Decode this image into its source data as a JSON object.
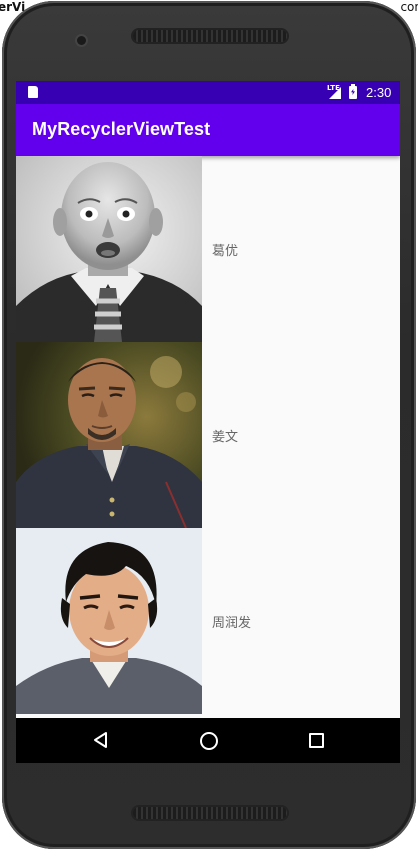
{
  "window": {
    "cut_title_left": "erVi",
    "cut_title_right": "con"
  },
  "status_bar": {
    "network": "LTE",
    "time": "2:30",
    "icons": [
      "sd-card-icon",
      "lte-signal-icon",
      "battery-charging-icon"
    ]
  },
  "app_bar": {
    "title": "MyRecyclerViewTest"
  },
  "list": {
    "items": [
      {
        "name": "葛优",
        "image": "bald-man-portrait"
      },
      {
        "name": "姜文",
        "image": "man-in-jacket-portrait"
      },
      {
        "name": "周润发",
        "image": "smiling-man-portrait"
      }
    ]
  },
  "nav_bar": {
    "icons": [
      "back-icon",
      "home-icon",
      "recents-icon"
    ]
  },
  "colors": {
    "status_bar": "#3700b3",
    "app_bar": "#6200ee",
    "list_background": "#fafafa",
    "nav_bar": "#000000",
    "item_text": "#666666"
  }
}
